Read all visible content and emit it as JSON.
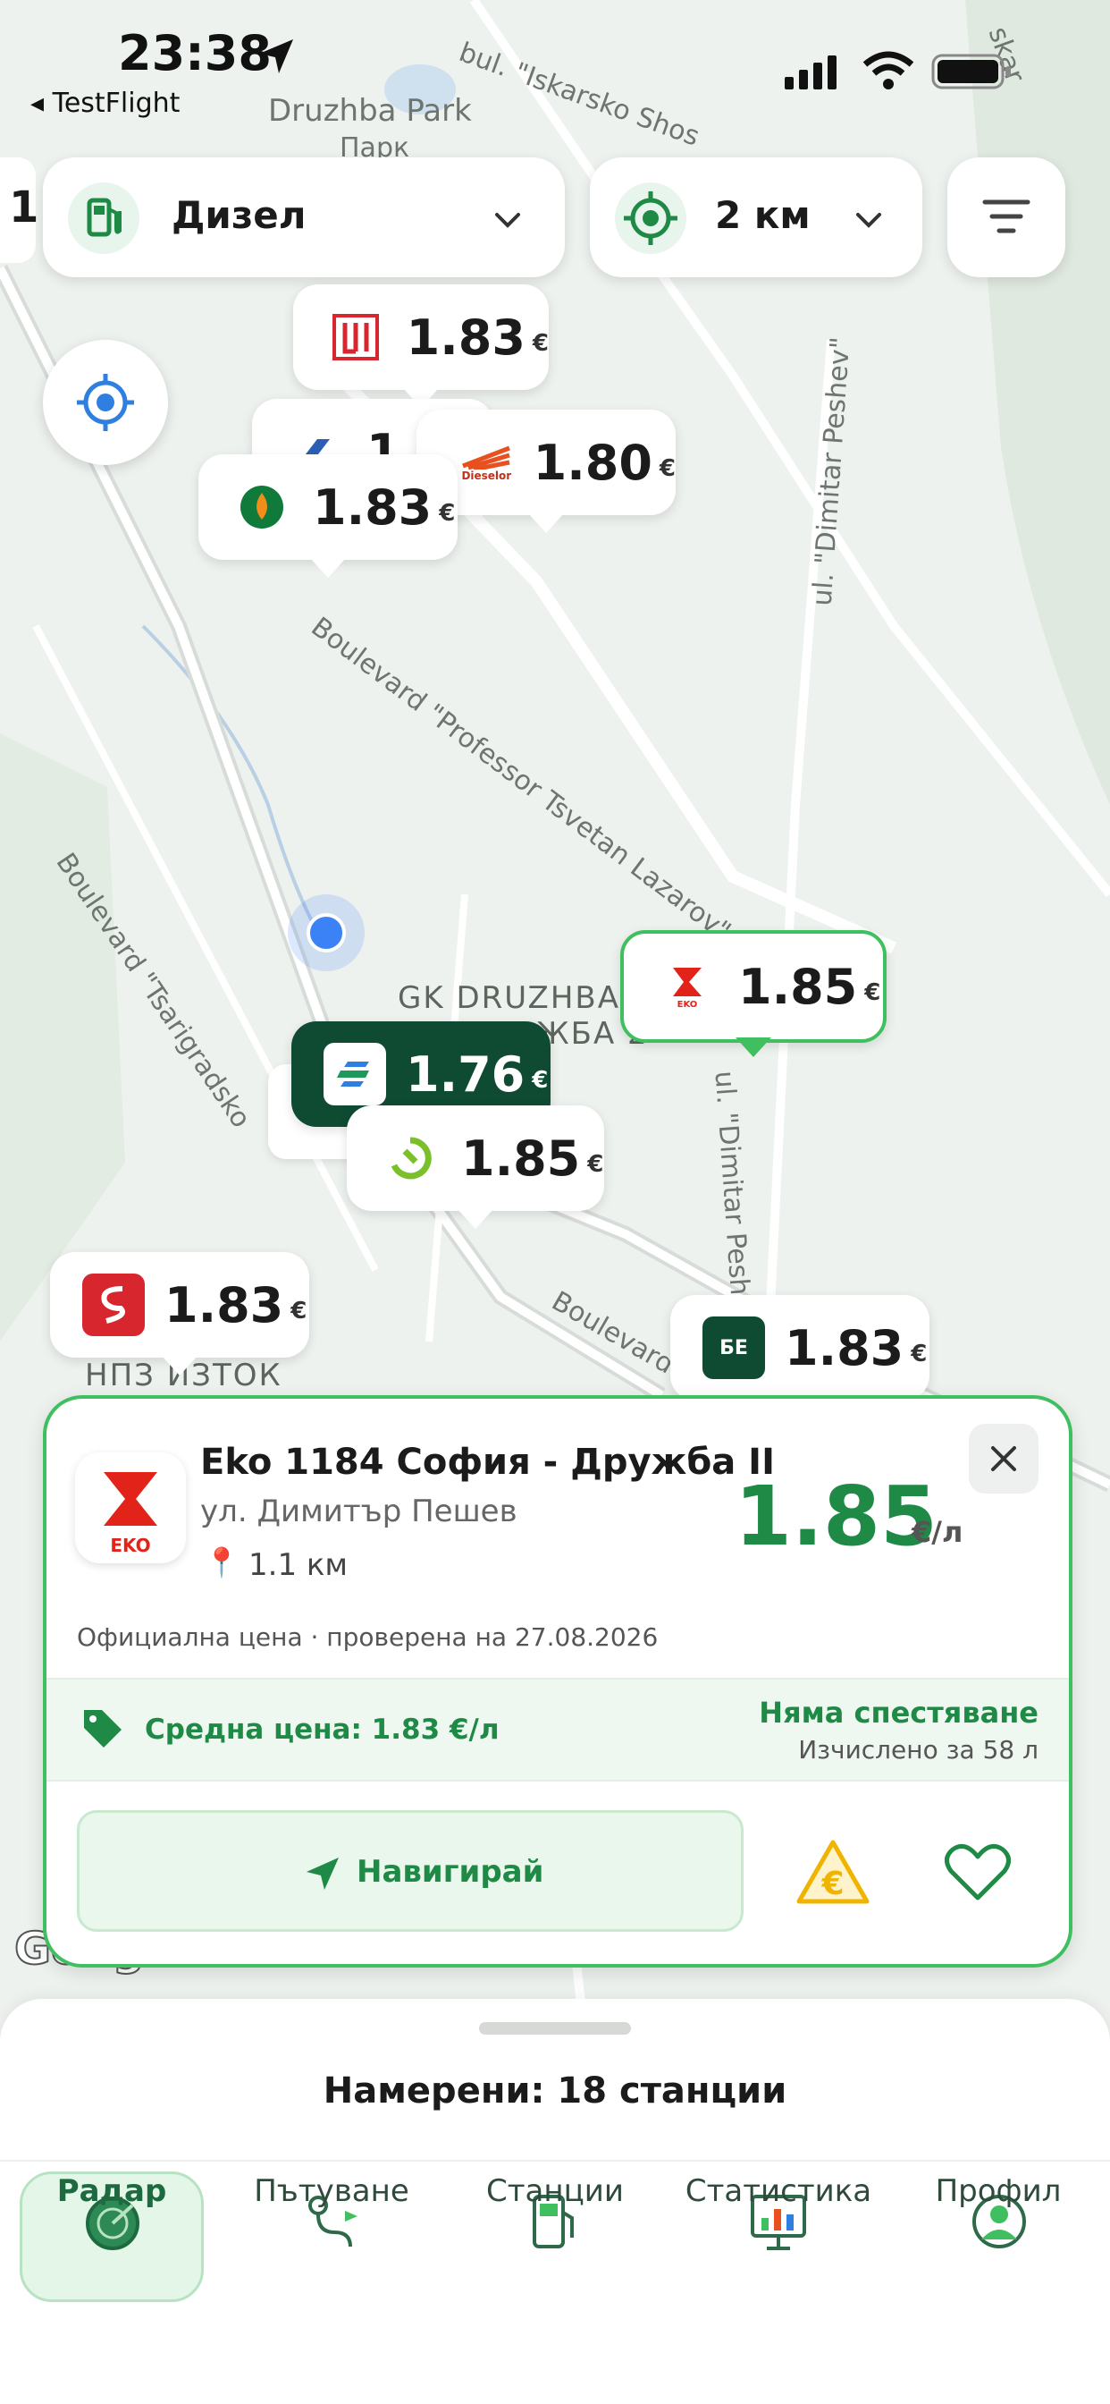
{
  "status_bar": {
    "time": "23:38",
    "back_app": "◂ TestFlight"
  },
  "map_labels": {
    "park": "Druzhba Park",
    "park2": "Парк",
    "street_iskarsko": "bul. \"Iskarsko Shos",
    "street_tsvetan": "Boulevard \"Professor Tsvetan Lazarov\"",
    "street_tsarigradsko": "Boulevard \"Tsarigradsko",
    "street_dimitar1": "ul. \"Dimitar Peshev\"",
    "street_dimitar2": "ul. \"Dimitar Peshev\"",
    "district": "GK DRUZHBA",
    "district_bg": "ЖБА 2",
    "npz": "НПЗ ИЗТОК",
    "boulevard": "Boulevard",
    "corner": "skar",
    "left_edge": "1."
  },
  "filters": {
    "fuel_label": "Дизел",
    "radius_label": "2 км"
  },
  "pins": [
    {
      "value": "1.83",
      "eur": "€"
    },
    {
      "value": "1.8",
      "eur": ""
    },
    {
      "value": "1.80",
      "eur": "€"
    },
    {
      "value": "1.83",
      "eur": "€"
    },
    {
      "value": "1.85",
      "eur": "€"
    },
    {
      "value": "1.76",
      "eur": "€"
    },
    {
      "value": "1.85",
      "eur": "€"
    },
    {
      "value": "1.83",
      "eur": "€"
    },
    {
      "value": "1.83",
      "eur": "€"
    }
  ],
  "brand_text": {
    "dieselor": "Dieselor",
    "be": "БЕ",
    "eko": "EKO"
  },
  "station_card": {
    "name": "Eko 1184 София - Дружба II",
    "address": "ул. Димитър Пешев",
    "distance": "1.1 км",
    "price": "1.85",
    "unit": "€/л",
    "verified": "Официална цена · проверена на 27.08.2026",
    "avg_price": "Средна цена: 1.83 €/л",
    "savings": "Няма спестяване",
    "calc": "Изчислено за 58 л",
    "navigate": "Навигирай"
  },
  "sheet": {
    "found": "Намерени: 18 станции"
  },
  "nav": [
    {
      "label": "Радар"
    },
    {
      "label": "Пътуване"
    },
    {
      "label": "Станции"
    },
    {
      "label": "Статистика"
    },
    {
      "label": "Профил"
    }
  ],
  "colors": {
    "accent": "#1e8a45",
    "card_border": "#3fbf5f",
    "dark_pin": "#0f4b32",
    "user_dot": "#3b82f6"
  }
}
